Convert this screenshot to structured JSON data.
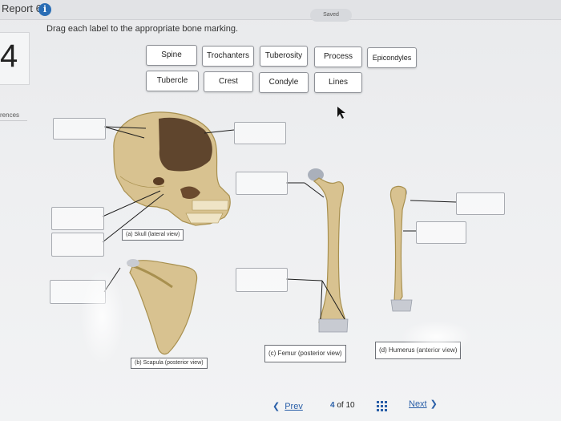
{
  "header": {
    "report_title": "Report 6",
    "saved_label": "Saved"
  },
  "instruction": "Drag each label to the appropriate bone marking.",
  "question_number": "4",
  "references_label": "rences",
  "labels": [
    "Spine",
    "Trochanters",
    "Tuberosity",
    "Process",
    "Epicondyles",
    "Tubercle",
    "Crest",
    "Condyle",
    "Lines"
  ],
  "captions": {
    "skull": "(a) Skull (lateral view)",
    "scapula": "(b) Scapula (posterior view)",
    "femur": "(c) Femur (posterior view)",
    "humerus": "(d) Humerus (anterior view)"
  },
  "nav": {
    "prev": "Prev",
    "current": "4",
    "of_label": "of",
    "total": "10",
    "next": "Next"
  },
  "colors": {
    "bone": "#d6c08f",
    "bone_shadow": "#b29a62",
    "accent": "#2a5fa8",
    "info_icon": "#2a6db5"
  },
  "icons": [
    "info-icon",
    "chevron-left-icon",
    "grid-icon",
    "chevron-right-icon",
    "cursor-icon"
  ]
}
